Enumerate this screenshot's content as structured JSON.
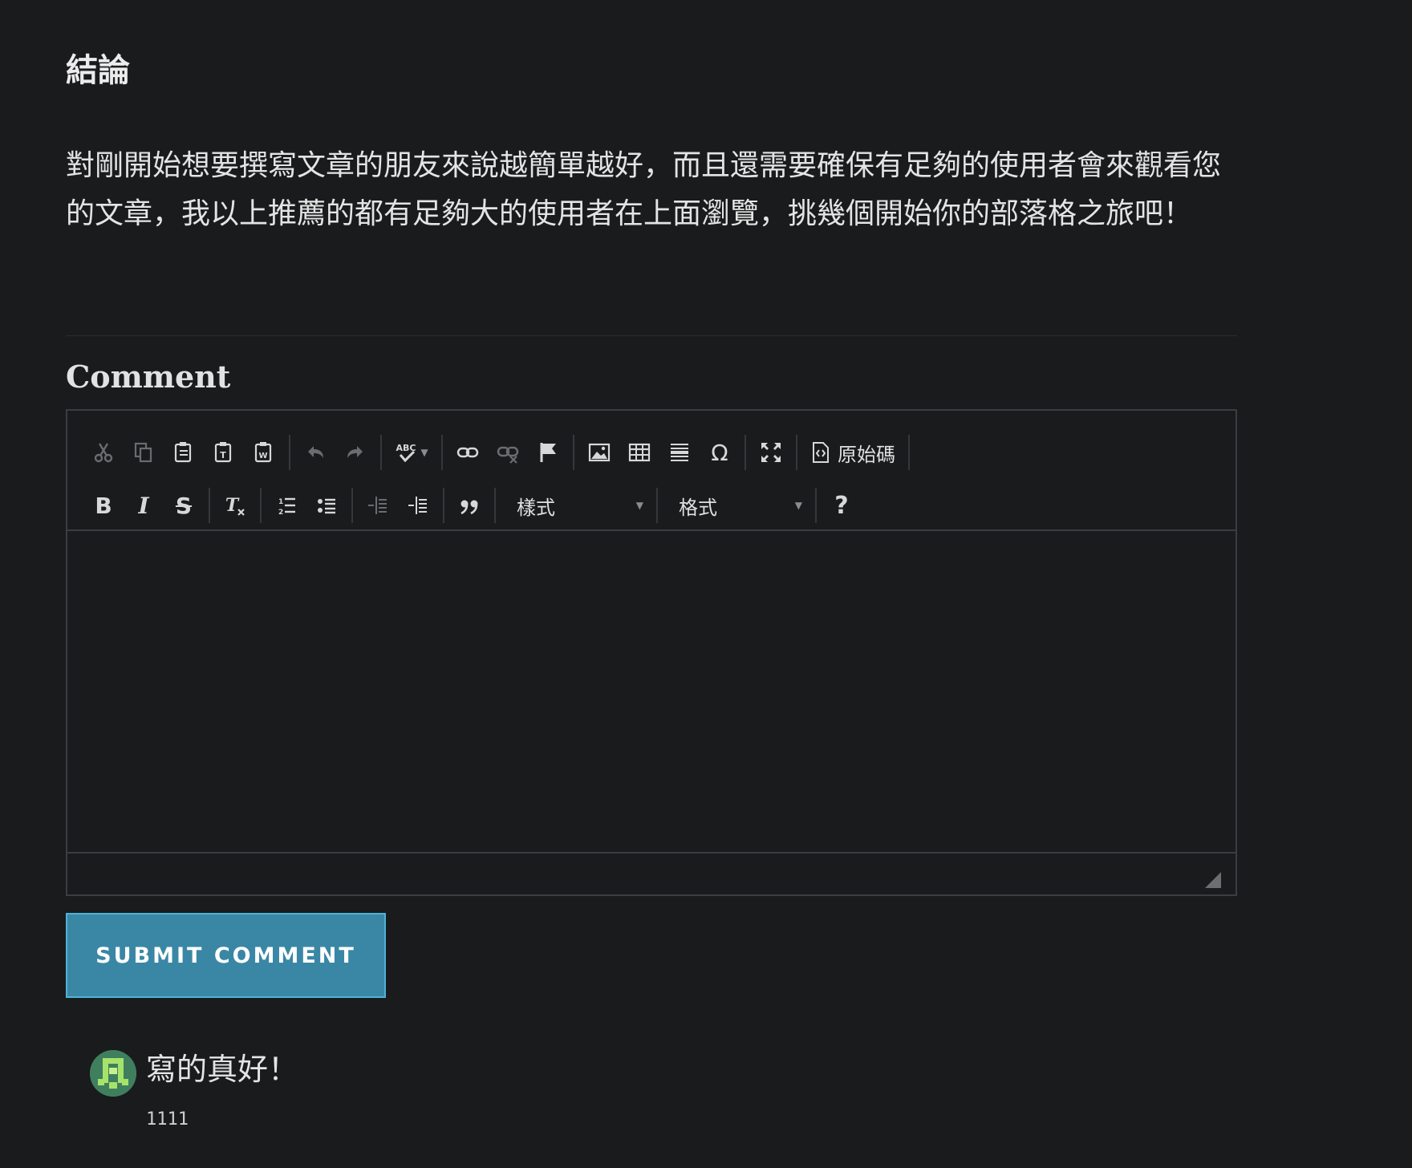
{
  "article": {
    "section_title": "結論",
    "conclusion_text": "對剛開始想要撰寫文章的朋友來說越簡單越好，而且還需要確保有足夠的使用者會來觀看您的文章，我以上推薦的都有足夠大的使用者在上面瀏覽，挑幾個開始你的部落格之旅吧！"
  },
  "comment_form": {
    "heading": "Comment",
    "toolbar": {
      "source_label": "原始碼",
      "style_combo_label": "樣式",
      "format_combo_label": "格式",
      "help_label": "?",
      "spellcheck_label": "ABC"
    },
    "submit_label": "SUBMIT COMMENT"
  },
  "comments": [
    {
      "text": "寫的真好！",
      "author": "1111"
    }
  ],
  "colors": {
    "background": "#1a1b1d",
    "submit_button": "#3a87a5",
    "submit_border": "#4cb3d9",
    "avatar": "#4a8f6a"
  }
}
